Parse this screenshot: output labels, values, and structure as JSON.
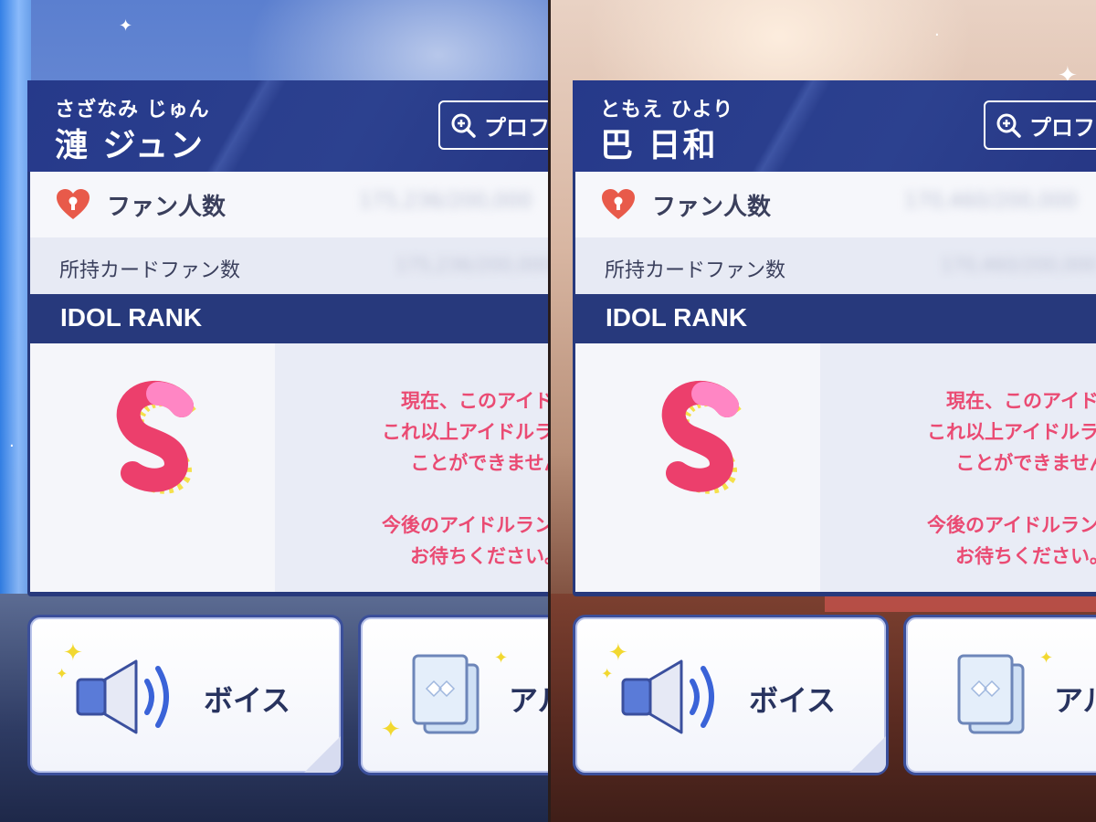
{
  "panels": [
    {
      "furigana": "さざなみ じゅん",
      "name": "漣 ジュン",
      "profile_button": "プロフ",
      "fan_count_label": "ファン人数",
      "fan_count_value": "175,236/200,000",
      "card_fans_label": "所持カードファン数",
      "card_fans_value": "175,236/200,000",
      "idol_rank_title": "IDOL RANK",
      "rank_message_lines": [
        "現在、このアイドル",
        "これ以上アイドルランク",
        "ことができません"
      ],
      "rank_message_lines_2": [
        "今後のアイドルランク上",
        "お待ちください。"
      ],
      "voice_button": "ボイス",
      "album_button": "アル"
    },
    {
      "furigana": "ともえ ひより",
      "name": "巴 日和",
      "profile_button": "プロフ",
      "fan_count_label": "ファン人数",
      "fan_count_value": "170,460/200,000",
      "card_fans_label": "所持カードファン数",
      "card_fans_value": "170,460/200,000",
      "idol_rank_title": "IDOL RANK",
      "rank_message_lines": [
        "現在、このアイドル",
        "これ以上アイドルランク",
        "ことができません"
      ],
      "rank_message_lines_2": [
        "今後のアイドルランク上",
        "お待ちください。"
      ],
      "voice_button": "ボイス",
      "album_button": "アル"
    }
  ],
  "colors": {
    "card_navy": "#27397c",
    "rank_pink": "#ea4b73",
    "sparkle_yellow": "#f2d830"
  },
  "icons": [
    "zoom-plus-icon",
    "heart-lock-icon",
    "rank-s-icon",
    "speaker-icon",
    "album-cards-icon"
  ]
}
